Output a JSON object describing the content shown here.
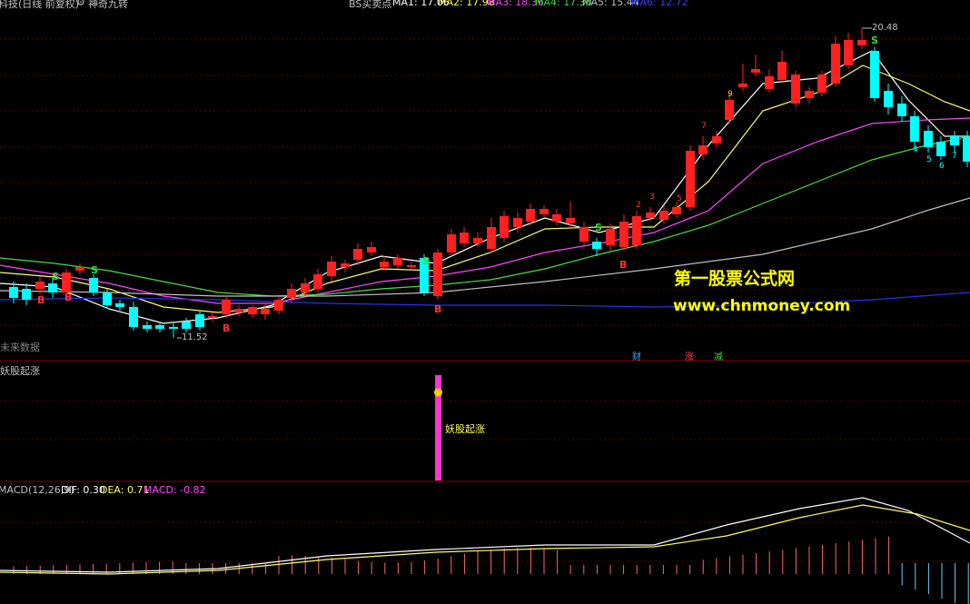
{
  "header": {
    "stock_title": "科技(日线 前复权)",
    "indicator_name": "神奇九转",
    "formula_name": "BS买卖点",
    "ma_values": [
      {
        "label": "MA1: 17.06",
        "color": "#ffffff"
      },
      {
        "label": "MA2: 17.98",
        "color": "#ffff66"
      },
      {
        "label": "MA3: 18.36",
        "color": "#ff44ff"
      },
      {
        "label": "MA4: 17.30",
        "color": "#44dd44"
      },
      {
        "label": "MA5: 15.44",
        "color": "#c0c0c0"
      },
      {
        "label": "MA6: 12.72",
        "color": "#3344ff"
      }
    ]
  },
  "main_chart": {
    "high_label": "20.48",
    "low_label": "11.52",
    "future_data_label": "未来数据",
    "event_markers": [
      {
        "label": "财",
        "color": "#4aa3ff"
      },
      {
        "label": "涨",
        "color": "#ff4444"
      },
      {
        "label": "减",
        "color": "#33dd33"
      }
    ],
    "signals": {
      "buy": "B",
      "sell": "S"
    }
  },
  "watermark": {
    "line1": "第一股票公式网",
    "line2": "www.chnmoney.com"
  },
  "sub_panel": {
    "title": "妖股起涨",
    "signal_label": "妖股起涨"
  },
  "macd_panel": {
    "title": "MACD(12,26,9)",
    "dif": "DIF: 0.30",
    "dea": "DEA: 0.71",
    "macd": "MACD: -0.82"
  },
  "colors": {
    "up": "#ff2020",
    "down": "#00ffff",
    "grid": "#8b0000",
    "text_yellow": "#ffff00",
    "text_magenta": "#ff33cc"
  },
  "chart_data": {
    "type": "candlestick",
    "low": 11.52,
    "high": 20.48,
    "last_close": 17.06,
    "moving_averages": {
      "MA1": 17.06,
      "MA2": 17.98,
      "MA3": 18.36,
      "MA4": 17.3,
      "MA5": 15.44,
      "MA6": 12.72
    },
    "macd": {
      "dif": 0.3,
      "dea": 0.71,
      "macd": -0.82
    }
  }
}
